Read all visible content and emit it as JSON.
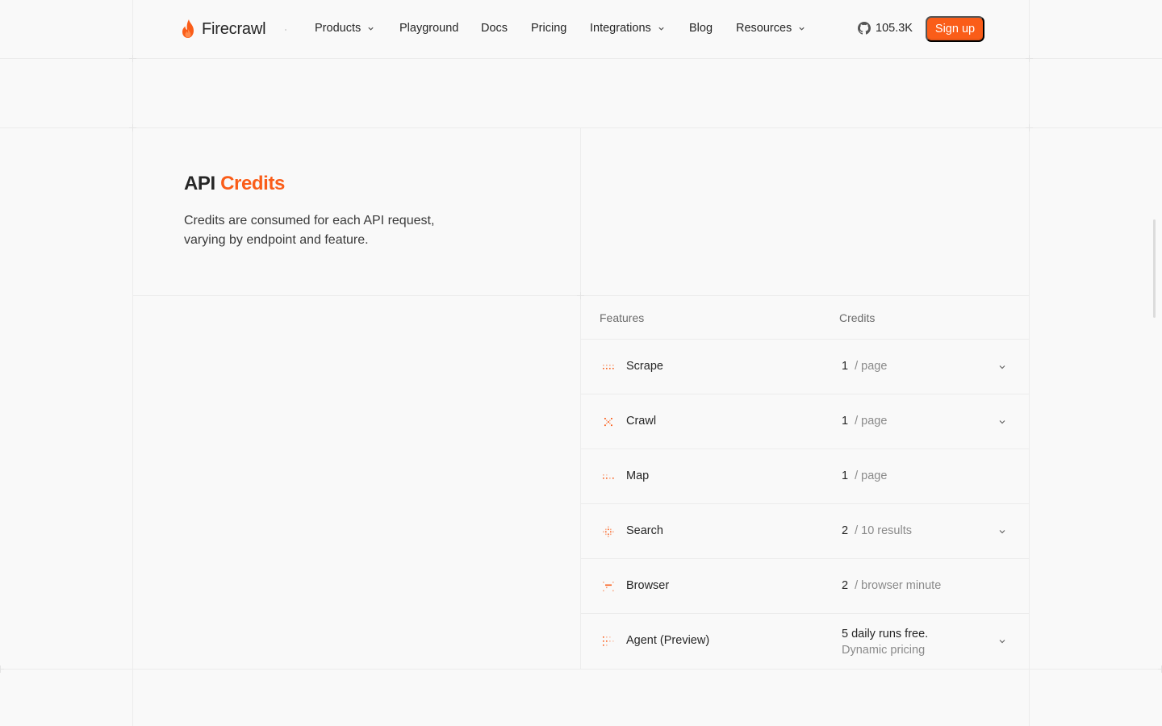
{
  "brand": {
    "name": "Firecrawl",
    "accent": "#fa5d19"
  },
  "nav": {
    "items": [
      {
        "label": "Products",
        "dropdown": true
      },
      {
        "label": "Playground",
        "dropdown": false
      },
      {
        "label": "Docs",
        "dropdown": false
      },
      {
        "label": "Pricing",
        "dropdown": false
      },
      {
        "label": "Integrations",
        "dropdown": true
      },
      {
        "label": "Blog",
        "dropdown": false
      },
      {
        "label": "Resources",
        "dropdown": true
      }
    ],
    "github_stars": "105.3K",
    "github_icon": "github-icon",
    "signup_label": "Sign up"
  },
  "hero": {
    "title_plain": "API",
    "title_accent": "Credits",
    "description": "Credits are consumed for each API request, varying by endpoint and feature."
  },
  "table": {
    "headers": {
      "features": "Features",
      "credits": "Credits"
    },
    "rows": [
      {
        "name": "Scrape",
        "credit": "1",
        "unit": "/ page",
        "expandable": true,
        "icon": "scrape-icon"
      },
      {
        "name": "Crawl",
        "credit": "1",
        "unit": "/ page",
        "expandable": true,
        "icon": "crawl-icon"
      },
      {
        "name": "Map",
        "credit": "1",
        "unit": "/ page",
        "expandable": false,
        "icon": "map-icon"
      },
      {
        "name": "Search",
        "credit": "2",
        "unit": "/ 10 results",
        "expandable": true,
        "icon": "search-icon"
      },
      {
        "name": "Browser",
        "credit": "2",
        "unit": "/ browser minute",
        "expandable": false,
        "icon": "browser-icon"
      },
      {
        "name": "Agent (Preview)",
        "credit": "5 daily runs free.",
        "unit": "Dynamic pricing",
        "expandable": true,
        "icon": "agent-icon"
      }
    ]
  }
}
